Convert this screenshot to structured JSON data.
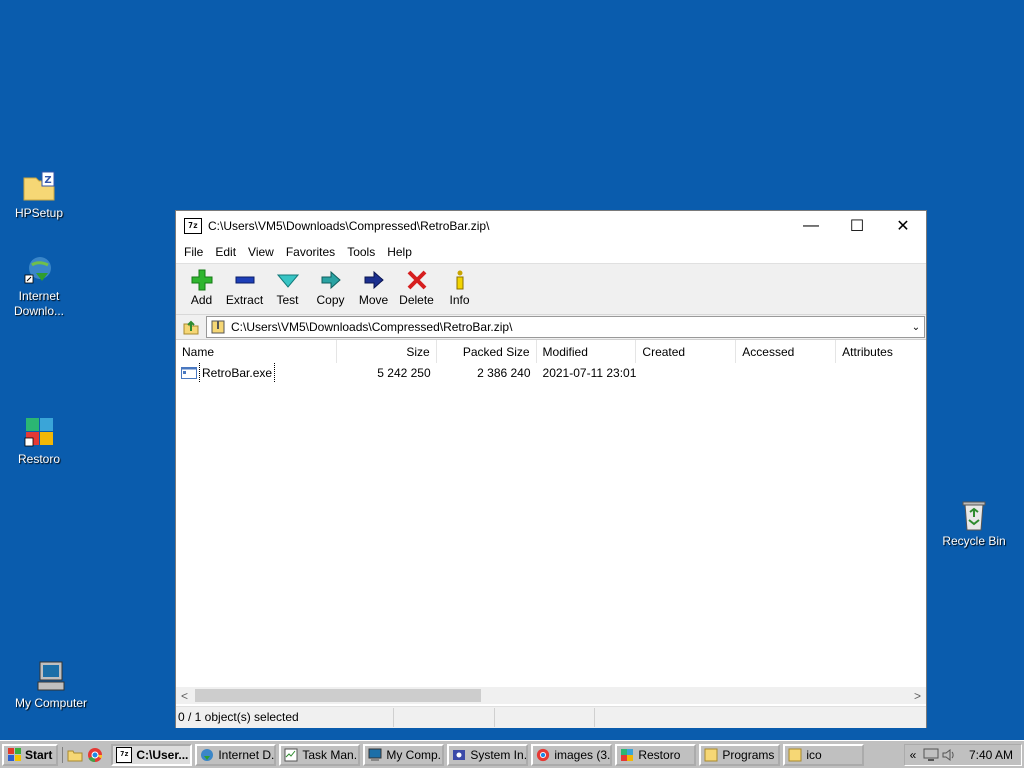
{
  "desktop": {
    "icons": [
      {
        "label": "HPSetup"
      },
      {
        "label": "Internet Downlo..."
      },
      {
        "label": "Restoro"
      },
      {
        "label": "Recycle Bin"
      },
      {
        "label": "My Computer"
      }
    ]
  },
  "window": {
    "title": "C:\\Users\\VM5\\Downloads\\Compressed\\RetroBar.zip\\",
    "app_icon": "7z",
    "controls": {
      "minimize": "—",
      "maximize": "☐",
      "close": "✕"
    },
    "menu": [
      "File",
      "Edit",
      "View",
      "Favorites",
      "Tools",
      "Help"
    ],
    "toolbar": [
      {
        "label": "Add",
        "icon": "add-icon"
      },
      {
        "label": "Extract",
        "icon": "extract-icon"
      },
      {
        "label": "Test",
        "icon": "test-icon"
      },
      {
        "label": "Copy",
        "icon": "copy-icon"
      },
      {
        "label": "Move",
        "icon": "move-icon"
      },
      {
        "label": "Delete",
        "icon": "delete-icon"
      },
      {
        "label": "Info",
        "icon": "info-icon"
      }
    ],
    "address": "C:\\Users\\VM5\\Downloads\\Compressed\\RetroBar.zip\\",
    "columns": [
      "Name",
      "Size",
      "Packed Size",
      "Modified",
      "Created",
      "Accessed",
      "Attributes"
    ],
    "rows": [
      {
        "name": "RetroBar.exe",
        "size": "5 242 250",
        "packed": "2 386 240",
        "modified": "2021-07-11 23:01",
        "created": "",
        "accessed": "",
        "attributes": ""
      }
    ],
    "status": "0 / 1 object(s) selected"
  },
  "taskbar": {
    "start": "Start",
    "buttons": [
      {
        "label": "C:\\User...",
        "active": true
      },
      {
        "label": "Internet D..."
      },
      {
        "label": "Task Man..."
      },
      {
        "label": "My Comp..."
      },
      {
        "label": "System In..."
      },
      {
        "label": "images (3..."
      },
      {
        "label": "Restoro"
      },
      {
        "label": "Programs"
      },
      {
        "label": "ico"
      }
    ],
    "tray_chevron": "«",
    "clock": "7:40 AM"
  },
  "colors": {
    "desktop": "#0a5cad",
    "taskbar": "#c0c0c0"
  }
}
